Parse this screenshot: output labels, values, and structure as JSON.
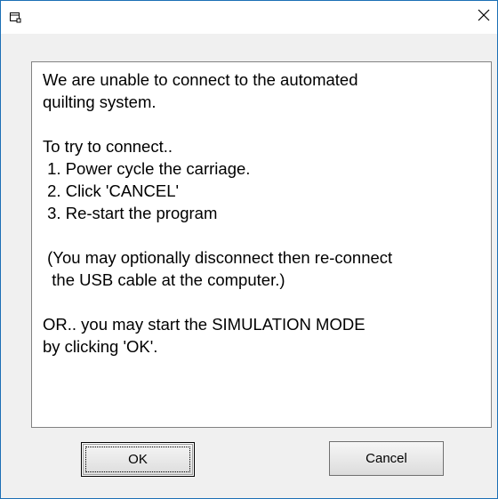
{
  "window": {
    "icon": "app-window-icon",
    "close_icon": "close-icon"
  },
  "message": {
    "lines": [
      "We are unable to connect to the automated",
      "quilting system.",
      "",
      "To try to connect..",
      " 1. Power cycle the carriage.",
      " 2. Click 'CANCEL'",
      " 3. Re-start the program",
      "",
      " (You may optionally disconnect then re-connect",
      "  the USB cable at the computer.)",
      "",
      "OR.. you may start the SIMULATION MODE",
      "by clicking 'OK'."
    ]
  },
  "buttons": {
    "ok_label": "OK",
    "cancel_label": "Cancel"
  },
  "colors": {
    "border_accent": "#1c6fb5",
    "dialog_background": "#f0f0f0",
    "message_background": "#ffffff"
  }
}
